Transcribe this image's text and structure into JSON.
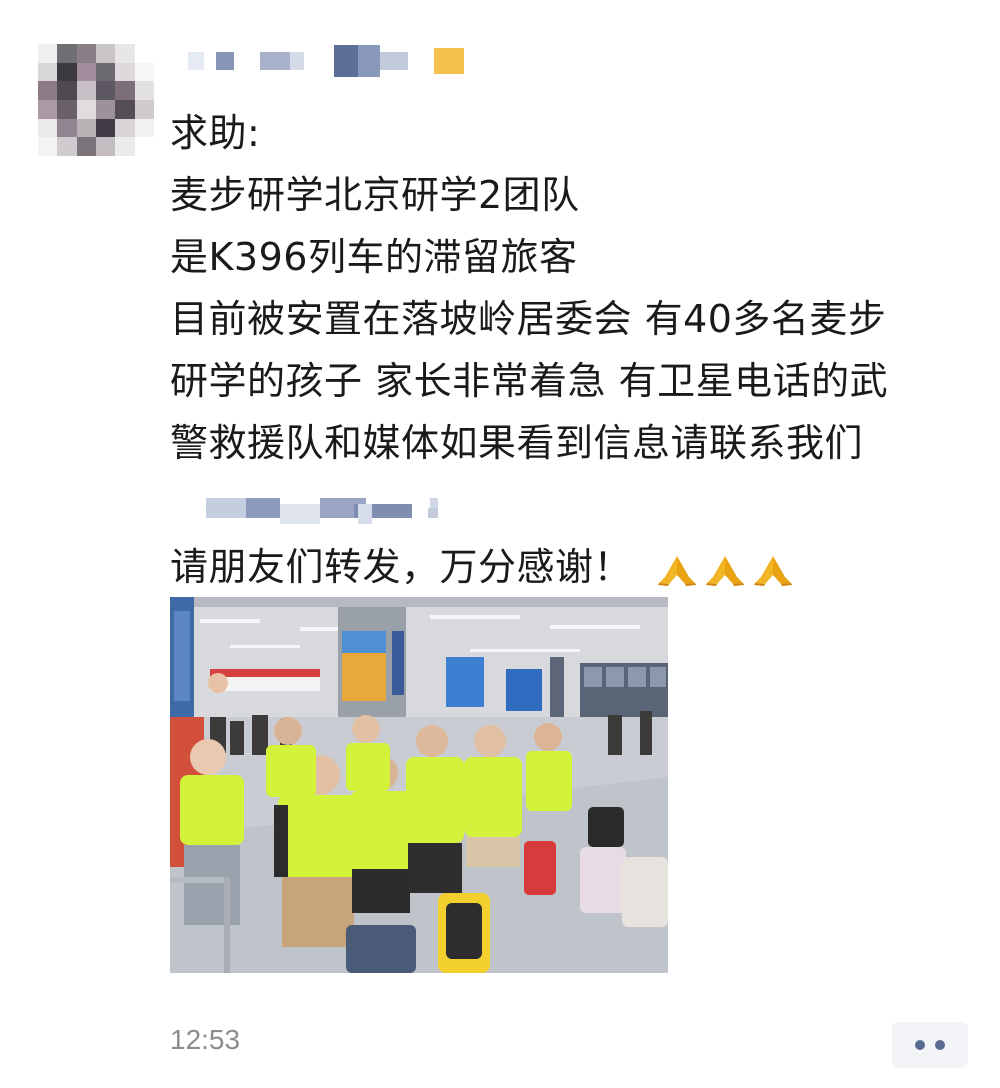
{
  "post": {
    "lines": [
      "求助:",
      "麦步研学北京研学2团队",
      "是K396列车的滞留旅客",
      "目前被安置在落坡岭居委会 有40多名麦步",
      "研学的孩子 家长非常着急 有卫星电话的武",
      "警救援队和媒体如果看到信息请联系我们"
    ],
    "closing": "请朋友们转发，万分感谢！",
    "timestamp": "12:53"
  },
  "icons": {
    "reaction": "praying-hands-icon",
    "more": "more-dots-icon"
  },
  "colors": {
    "text": "#1a1a1a",
    "timestamp": "#8c8c8c",
    "more_button_bg": "#f3f4f7",
    "more_dots": "#5a6b92",
    "shirt_green": "#d3f23a"
  }
}
